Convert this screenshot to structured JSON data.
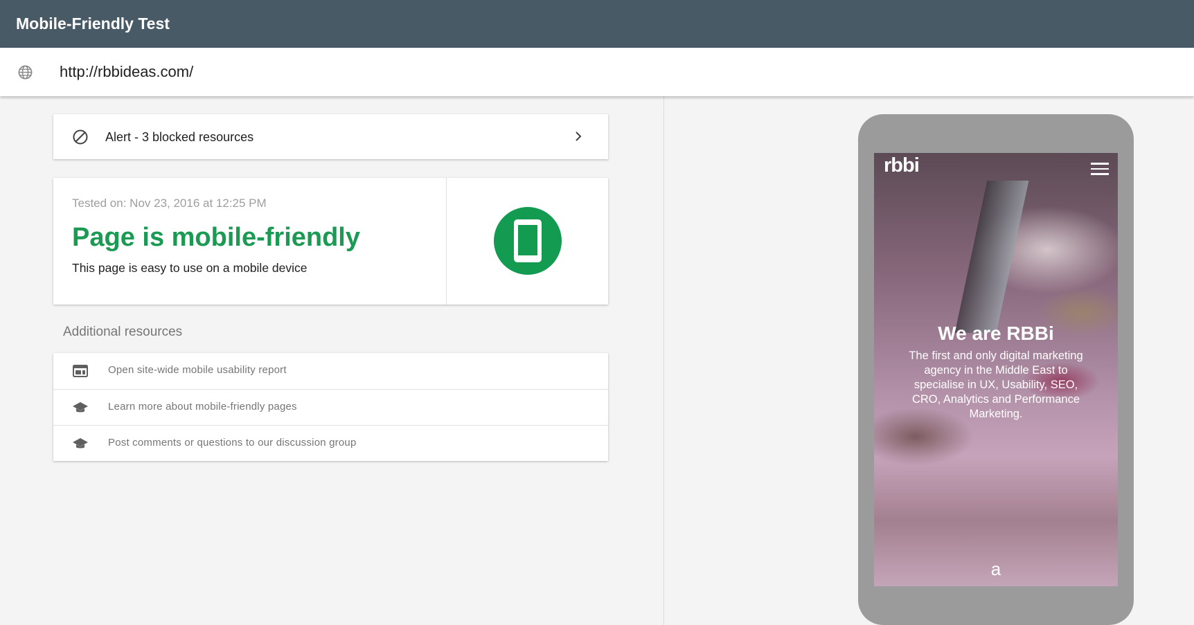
{
  "app": {
    "title": "Mobile-Friendly Test"
  },
  "urlbar": {
    "icon": "globe-icon",
    "url": "http://rbbideas.com/"
  },
  "alert": {
    "icon": "blocked-icon",
    "label": "Alert - 3 blocked resources",
    "action_icon": "chevron-right-icon"
  },
  "result": {
    "tested_on": "Tested on: Nov 23, 2016 at 12:25 PM",
    "headline": "Page is mobile-friendly",
    "subtext": "This page is easy to use on a mobile device",
    "badge_icon": "smartphone-icon",
    "status_color": "#139b52"
  },
  "additional": {
    "title": "Additional resources",
    "items": [
      {
        "icon": "web-layout-icon",
        "label": "Open site-wide mobile usability report"
      },
      {
        "icon": "school-icon",
        "label": "Learn more about mobile-friendly pages"
      },
      {
        "icon": "school-icon",
        "label": "Post comments or questions to our discussion group"
      }
    ]
  },
  "preview": {
    "brand": "rbbi",
    "menu_icon": "hamburger-menu-icon",
    "hero_title": "We are RBBi",
    "hero_text": "The first and only digital marketing agency in the Middle East to specialise in UX, Usability, SEO, CRO, Analytics and Performance Marketing.",
    "scroll_glyph": "a"
  },
  "colors": {
    "topbar": "#485a66",
    "success_green": "#1a9a52",
    "device_frame": "#9b9b9b"
  }
}
